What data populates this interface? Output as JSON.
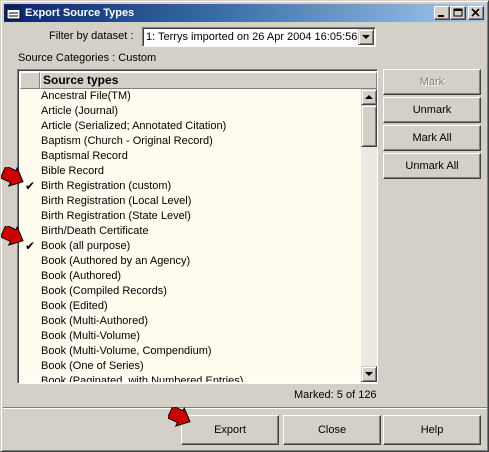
{
  "window": {
    "title": "Export Source Types",
    "controls": {
      "minimize": "minimize-icon",
      "maximize": "maximize-icon",
      "close": "close-icon"
    }
  },
  "filter": {
    "label": "Filter by dataset :",
    "selected": "1:  Terrys imported on 26 Apr 2004 16:05:56"
  },
  "categories_label": "Source Categories : Custom",
  "list": {
    "header": "Source types",
    "items": [
      {
        "label": "Ancestral File(TM)",
        "checked": false
      },
      {
        "label": "Article (Journal)",
        "checked": false
      },
      {
        "label": "Article (Serialized; Annotated Citation)",
        "checked": false
      },
      {
        "label": "Baptism (Church - Original Record)",
        "checked": false
      },
      {
        "label": "Baptismal Record",
        "checked": false
      },
      {
        "label": "Bible Record",
        "checked": false
      },
      {
        "label": "Birth Registration (custom)",
        "checked": true
      },
      {
        "label": "Birth Registration (Local Level)",
        "checked": false
      },
      {
        "label": "Birth Registration (State Level)",
        "checked": false
      },
      {
        "label": "Birth/Death Certificate",
        "checked": false
      },
      {
        "label": "Book (all purpose)",
        "checked": true
      },
      {
        "label": "Book (Authored by an Agency)",
        "checked": false
      },
      {
        "label": "Book (Authored)",
        "checked": false
      },
      {
        "label": "Book (Compiled Records)",
        "checked": false
      },
      {
        "label": "Book (Edited)",
        "checked": false
      },
      {
        "label": "Book (Multi-Authored)",
        "checked": false
      },
      {
        "label": "Book (Multi-Volume)",
        "checked": false
      },
      {
        "label": "Book (Multi-Volume, Compendium)",
        "checked": false
      },
      {
        "label": "Book (One of Series)",
        "checked": false
      },
      {
        "label": "Book (Paginated, with Numbered Entries)",
        "checked": false
      }
    ]
  },
  "side_buttons": {
    "mark": "Mark",
    "unmark": "Unmark",
    "mark_all": "Mark All",
    "unmark_all": "Unmark All"
  },
  "status": {
    "marked": "Marked: 5 of 126"
  },
  "bottom_buttons": {
    "export": "Export",
    "close": "Close",
    "help": "Help"
  },
  "colors": {
    "title_gradient_start": "#0a246a",
    "title_gradient_end": "#a6caf0",
    "list_background": "#fffcf0",
    "annotation_arrow": "#cc0000"
  }
}
